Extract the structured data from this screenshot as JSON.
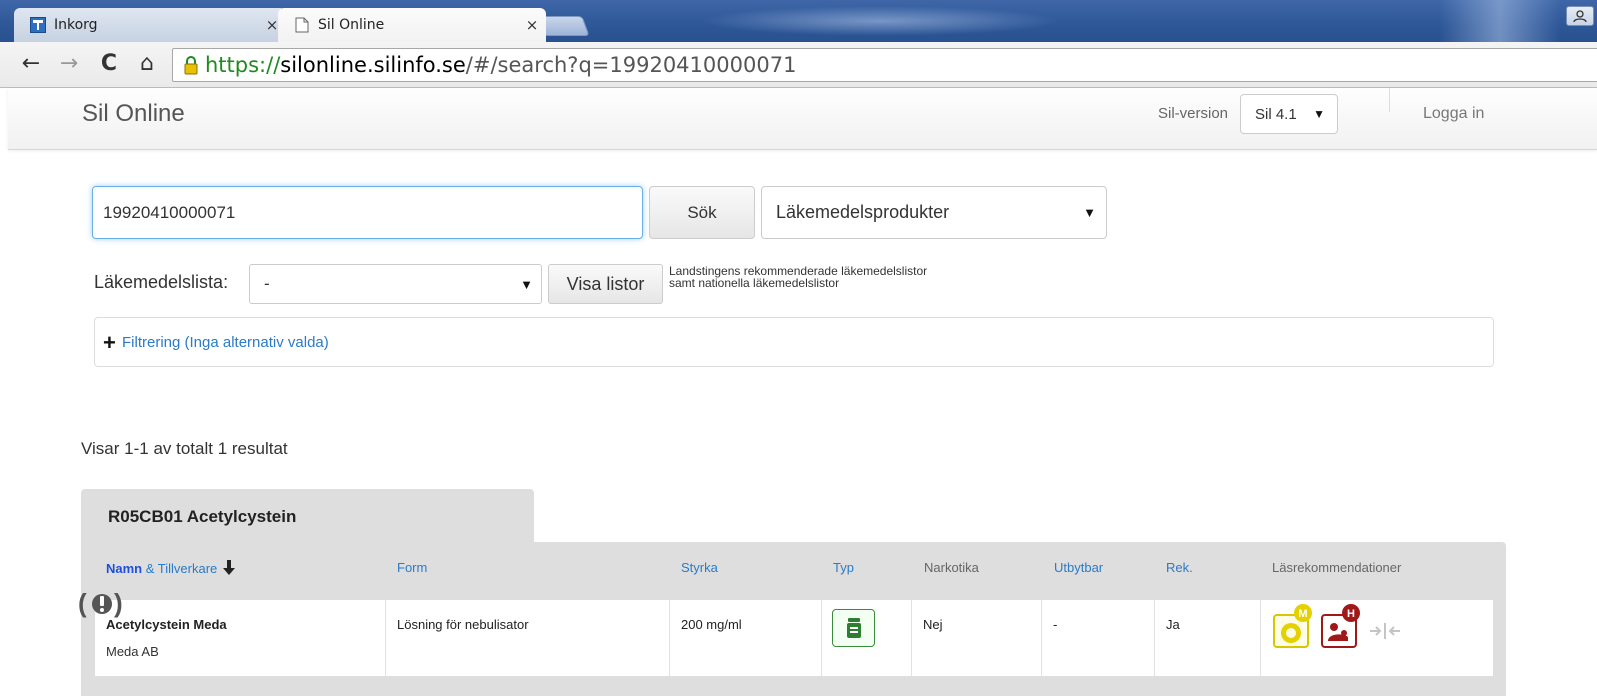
{
  "browser": {
    "tabs": [
      {
        "title": "Inkorg",
        "close": "×"
      },
      {
        "title": "Sil Online",
        "close": "×"
      }
    ],
    "nav": {
      "back": "←",
      "forward": "→",
      "reload": "C",
      "home": "⌂"
    },
    "url": {
      "scheme": "https://",
      "host": "silonline.silinfo.se",
      "path": "/#/search?q=19920410000071"
    }
  },
  "header": {
    "brand": "Sil Online",
    "version_label": "Sil-version",
    "version_value": "Sil 4.1",
    "login": "Logga in"
  },
  "search": {
    "query": "19920410000071",
    "button": "Sök",
    "type_value": "Läkemedelsprodukter"
  },
  "lists": {
    "label": "Läkemedelslista:",
    "value": "-",
    "button": "Visa listor",
    "help_line1": "Landstingens rekommenderade läkemedelslistor",
    "help_line2": "samt nationella läkemedelslistor"
  },
  "filter": {
    "link": "Filtrering (Inga alternativ valda)"
  },
  "results": {
    "summary": "Visar 1-1 av totalt 1 resultat",
    "group_title": "R05CB01 Acetylcystein",
    "columns": {
      "name_bold": "Namn",
      "name_rest": " & Tillverkare",
      "form": "Form",
      "strength": "Styrka",
      "type": "Typ",
      "narcotic": "Narkotika",
      "exchangeable": "Utbytbar",
      "rec": "Rek.",
      "reading": "Läsrekommendationer"
    },
    "rows": [
      {
        "name": "Acetylcystein Meda",
        "manufacturer": "Meda AB",
        "form": "Lösning för nebulisator",
        "strength": "200 mg/ml",
        "narcotic": "Nej",
        "exchangeable": "-",
        "rec": "Ja",
        "badge_m": "M",
        "badge_h": "H"
      }
    ]
  },
  "colors": {
    "link": "#2a7bc8",
    "focus": "#66afe9",
    "badge_m": "#e5d000",
    "badge_h": "#a01818",
    "type_icon": "#3b8b3b"
  }
}
